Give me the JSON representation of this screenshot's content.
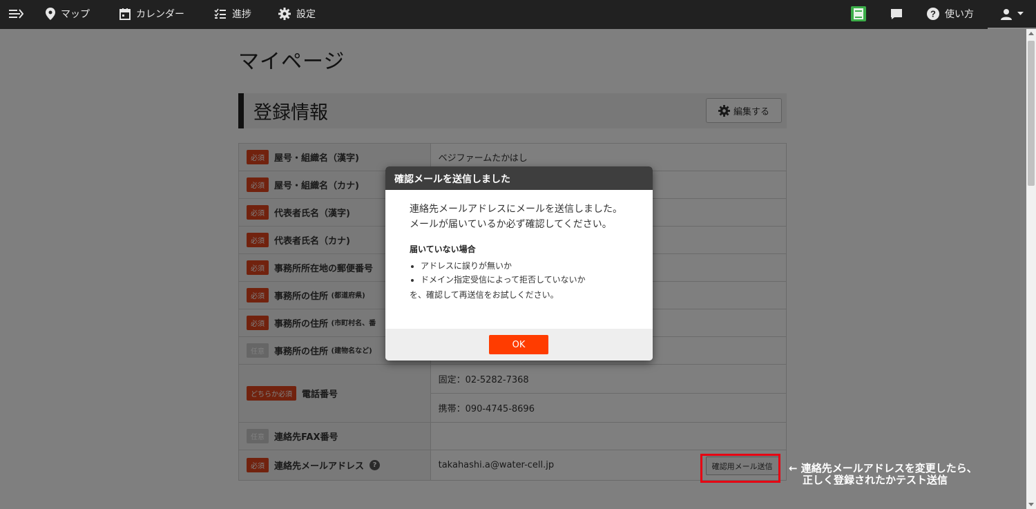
{
  "nav": {
    "items": [
      {
        "label": "マップ",
        "icon": "map-pin-icon"
      },
      {
        "label": "カレンダー",
        "icon": "calendar-icon"
      },
      {
        "label": "進捗",
        "icon": "checklist-icon"
      },
      {
        "label": "設定",
        "icon": "gear-icon"
      }
    ],
    "help_label": "使い方",
    "menu_icon": "menu-collapse-icon",
    "notebook_icon": "notebook-icon",
    "chat_icon": "chat-icon",
    "user_icon": "user-icon"
  },
  "page": {
    "title": "マイページ",
    "section_title": "登録情報",
    "edit_button": "編集する"
  },
  "table": {
    "rows": [
      {
        "badge": "必須",
        "label": "屋号・組織名（漢字)",
        "small": "",
        "value": "ベジファームたかはし"
      },
      {
        "badge": "必須",
        "label": "屋号・組織名（カナ)",
        "small": "",
        "value": ""
      },
      {
        "badge": "必須",
        "label": "代表者氏名（漢字)",
        "small": "",
        "value": ""
      },
      {
        "badge": "必須",
        "label": "代表者氏名（カナ)",
        "small": "",
        "value": ""
      },
      {
        "badge": "必須",
        "label": "事務所所在地の郵便番号",
        "small": "",
        "value": ""
      },
      {
        "badge": "必須",
        "label": "事務所の住所 ",
        "small": "(都道府県)",
        "value": ""
      },
      {
        "badge": "必須",
        "label": "事務所の住所 ",
        "small": "(市町村名、番",
        "value": ""
      },
      {
        "badge": "任意",
        "label": "事務所の住所 ",
        "small": "(建物名など)",
        "value": ""
      }
    ],
    "phone": {
      "badge": "どちらか必須",
      "label": "電話番号",
      "fixed": "固定：02-5282-7368",
      "mobile": "携帯：090-4745-8696"
    },
    "fax": {
      "badge": "任意",
      "label": "連絡先FAX番号",
      "value": ""
    },
    "email": {
      "badge": "必須",
      "label": "連絡先メールアドレス",
      "help": "?",
      "value": "takahashi.a@water-cell.jp",
      "confirm_button": "確認用メール送信"
    }
  },
  "modal": {
    "title": "確認メールを送信しました",
    "line1": "連絡先メールアドレスにメールを送信しました。",
    "line2": "メールが届いているか必ず確認してください。",
    "subheading": "届いていない場合",
    "bullets": [
      "アドレスに誤りが無いか",
      "ドメイン指定受信によって拒否していないか"
    ],
    "closing": "を、確認して再送信をお試しください。",
    "ok": "OK"
  },
  "annotation": {
    "line1": "← 連絡先メールアドレスを変更したら、",
    "line2": "正しく登録されたかテスト送信"
  },
  "colors": {
    "required_badge": "#e2441c",
    "optional_badge": "#cccccc",
    "ok_button": "#ff3c00",
    "highlight": "#e60012"
  }
}
